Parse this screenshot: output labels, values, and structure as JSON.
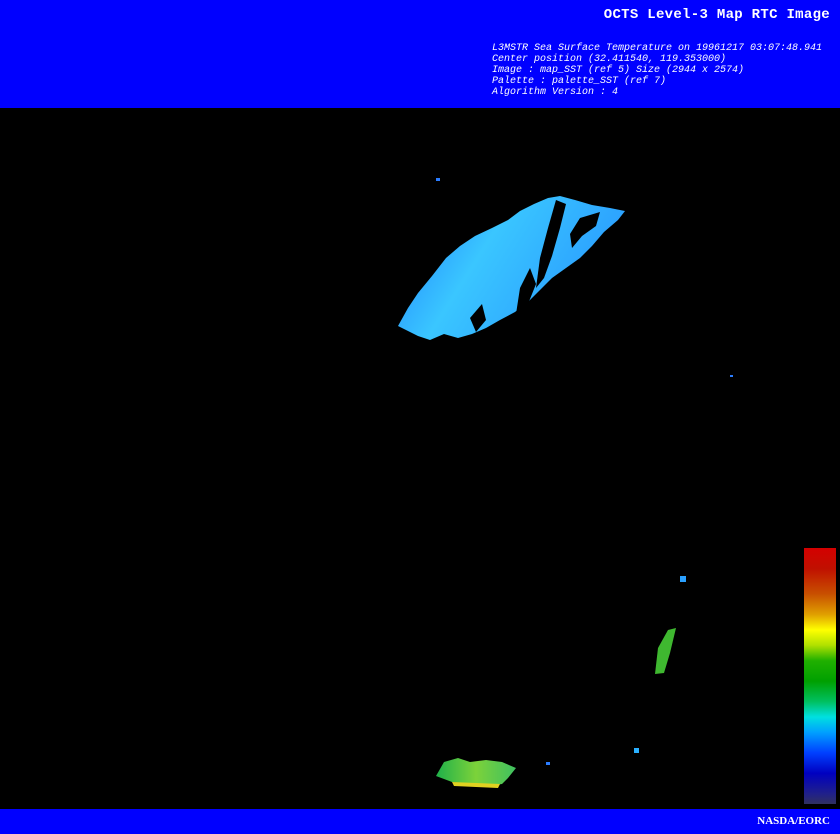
{
  "header": {
    "title": "OCTS Level-3 Map RTC Image",
    "meta_lines": [
      "L3MSTR Sea Surface Temperature on 19961217 03:07:48.941",
      "Center position (32.411540, 119.353000)",
      "Image : map_SST (ref 5) Size (2944 x 2574)",
      "Palette : palette_SST (ref 7)",
      "Algorithm Version : 4"
    ]
  },
  "footer": {
    "credit": "NASDA/EORC"
  },
  "colors": {
    "banner": "#0000ff",
    "background": "#000000",
    "text": "#ffffff"
  }
}
